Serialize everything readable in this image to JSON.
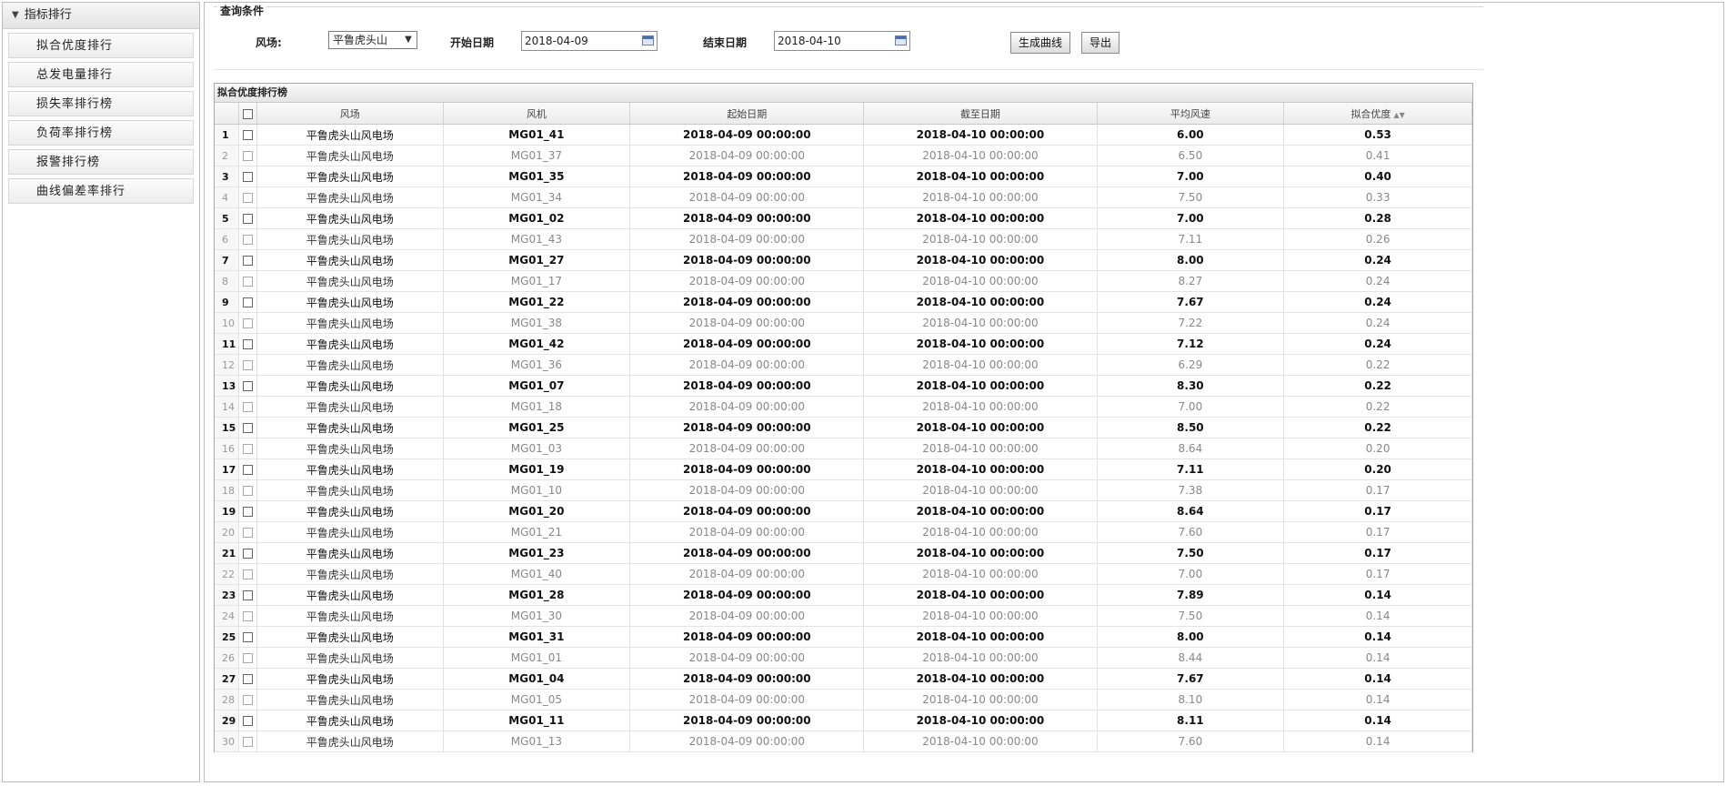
{
  "sidebar": {
    "header": "指标排行",
    "items": [
      {
        "label": "拟合优度排行"
      },
      {
        "label": "总发电量排行"
      },
      {
        "label": "损失率排行榜"
      },
      {
        "label": "负荷率排行榜"
      },
      {
        "label": "报警排行榜"
      },
      {
        "label": "曲线偏差率排行"
      }
    ]
  },
  "query": {
    "legend": "查询条件",
    "farm_label": "风场:",
    "farm_value": "平鲁虎头山",
    "start_label": "开始日期",
    "start_value": "2018-04-09",
    "end_label": "结束日期",
    "end_value": "2018-04-10",
    "generate_button": "生成曲线",
    "export_button": "导出"
  },
  "grid": {
    "title": "拟合优度排行榜",
    "columns": [
      "风场",
      "风机",
      "起始日期",
      "截至日期",
      "平均风速",
      "拟合优度"
    ],
    "rows": [
      [
        "1",
        "平鲁虎头山风电场",
        "MG01_41",
        "2018-04-09 00:00:00",
        "2018-04-10 00:00:00",
        "6.00",
        "0.53"
      ],
      [
        "2",
        "平鲁虎头山风电场",
        "MG01_37",
        "2018-04-09 00:00:00",
        "2018-04-10 00:00:00",
        "6.50",
        "0.41"
      ],
      [
        "3",
        "平鲁虎头山风电场",
        "MG01_35",
        "2018-04-09 00:00:00",
        "2018-04-10 00:00:00",
        "7.00",
        "0.40"
      ],
      [
        "4",
        "平鲁虎头山风电场",
        "MG01_34",
        "2018-04-09 00:00:00",
        "2018-04-10 00:00:00",
        "7.50",
        "0.33"
      ],
      [
        "5",
        "平鲁虎头山风电场",
        "MG01_02",
        "2018-04-09 00:00:00",
        "2018-04-10 00:00:00",
        "7.00",
        "0.28"
      ],
      [
        "6",
        "平鲁虎头山风电场",
        "MG01_43",
        "2018-04-09 00:00:00",
        "2018-04-10 00:00:00",
        "7.11",
        "0.26"
      ],
      [
        "7",
        "平鲁虎头山风电场",
        "MG01_27",
        "2018-04-09 00:00:00",
        "2018-04-10 00:00:00",
        "8.00",
        "0.24"
      ],
      [
        "8",
        "平鲁虎头山风电场",
        "MG01_17",
        "2018-04-09 00:00:00",
        "2018-04-10 00:00:00",
        "8.27",
        "0.24"
      ],
      [
        "9",
        "平鲁虎头山风电场",
        "MG01_22",
        "2018-04-09 00:00:00",
        "2018-04-10 00:00:00",
        "7.67",
        "0.24"
      ],
      [
        "10",
        "平鲁虎头山风电场",
        "MG01_38",
        "2018-04-09 00:00:00",
        "2018-04-10 00:00:00",
        "7.22",
        "0.24"
      ],
      [
        "11",
        "平鲁虎头山风电场",
        "MG01_42",
        "2018-04-09 00:00:00",
        "2018-04-10 00:00:00",
        "7.12",
        "0.24"
      ],
      [
        "12",
        "平鲁虎头山风电场",
        "MG01_36",
        "2018-04-09 00:00:00",
        "2018-04-10 00:00:00",
        "6.29",
        "0.22"
      ],
      [
        "13",
        "平鲁虎头山风电场",
        "MG01_07",
        "2018-04-09 00:00:00",
        "2018-04-10 00:00:00",
        "8.30",
        "0.22"
      ],
      [
        "14",
        "平鲁虎头山风电场",
        "MG01_18",
        "2018-04-09 00:00:00",
        "2018-04-10 00:00:00",
        "7.00",
        "0.22"
      ],
      [
        "15",
        "平鲁虎头山风电场",
        "MG01_25",
        "2018-04-09 00:00:00",
        "2018-04-10 00:00:00",
        "8.50",
        "0.22"
      ],
      [
        "16",
        "平鲁虎头山风电场",
        "MG01_03",
        "2018-04-09 00:00:00",
        "2018-04-10 00:00:00",
        "8.64",
        "0.20"
      ],
      [
        "17",
        "平鲁虎头山风电场",
        "MG01_19",
        "2018-04-09 00:00:00",
        "2018-04-10 00:00:00",
        "7.11",
        "0.20"
      ],
      [
        "18",
        "平鲁虎头山风电场",
        "MG01_10",
        "2018-04-09 00:00:00",
        "2018-04-10 00:00:00",
        "7.38",
        "0.17"
      ],
      [
        "19",
        "平鲁虎头山风电场",
        "MG01_20",
        "2018-04-09 00:00:00",
        "2018-04-10 00:00:00",
        "8.64",
        "0.17"
      ],
      [
        "20",
        "平鲁虎头山风电场",
        "MG01_21",
        "2018-04-09 00:00:00",
        "2018-04-10 00:00:00",
        "7.60",
        "0.17"
      ],
      [
        "21",
        "平鲁虎头山风电场",
        "MG01_23",
        "2018-04-09 00:00:00",
        "2018-04-10 00:00:00",
        "7.50",
        "0.17"
      ],
      [
        "22",
        "平鲁虎头山风电场",
        "MG01_40",
        "2018-04-09 00:00:00",
        "2018-04-10 00:00:00",
        "7.00",
        "0.17"
      ],
      [
        "23",
        "平鲁虎头山风电场",
        "MG01_28",
        "2018-04-09 00:00:00",
        "2018-04-10 00:00:00",
        "7.89",
        "0.14"
      ],
      [
        "24",
        "平鲁虎头山风电场",
        "MG01_30",
        "2018-04-09 00:00:00",
        "2018-04-10 00:00:00",
        "7.50",
        "0.14"
      ],
      [
        "25",
        "平鲁虎头山风电场",
        "MG01_31",
        "2018-04-09 00:00:00",
        "2018-04-10 00:00:00",
        "8.00",
        "0.14"
      ],
      [
        "26",
        "平鲁虎头山风电场",
        "MG01_01",
        "2018-04-09 00:00:00",
        "2018-04-10 00:00:00",
        "8.44",
        "0.14"
      ],
      [
        "27",
        "平鲁虎头山风电场",
        "MG01_04",
        "2018-04-09 00:00:00",
        "2018-04-10 00:00:00",
        "7.67",
        "0.14"
      ],
      [
        "28",
        "平鲁虎头山风电场",
        "MG01_05",
        "2018-04-09 00:00:00",
        "2018-04-10 00:00:00",
        "8.10",
        "0.14"
      ],
      [
        "29",
        "平鲁虎头山风电场",
        "MG01_11",
        "2018-04-09 00:00:00",
        "2018-04-10 00:00:00",
        "8.11",
        "0.14"
      ],
      [
        "30",
        "平鲁虎头山风电场",
        "MG01_13",
        "2018-04-09 00:00:00",
        "2018-04-10 00:00:00",
        "7.60",
        "0.14"
      ]
    ]
  }
}
